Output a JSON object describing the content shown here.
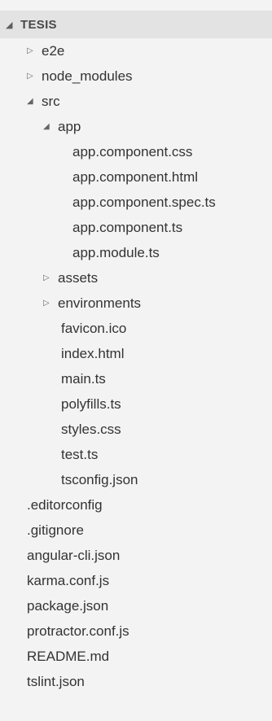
{
  "explorer": {
    "section_title": "TESIS",
    "twisty_expanded": "◢",
    "twisty_collapsed": "▷",
    "items": [
      {
        "label": "e2e"
      },
      {
        "label": "node_modules"
      },
      {
        "label": "src"
      },
      {
        "label": "app"
      },
      {
        "label": "app.component.css"
      },
      {
        "label": "app.component.html"
      },
      {
        "label": "app.component.spec.ts"
      },
      {
        "label": "app.component.ts"
      },
      {
        "label": "app.module.ts"
      },
      {
        "label": "assets"
      },
      {
        "label": "environments"
      },
      {
        "label": "favicon.ico"
      },
      {
        "label": "index.html"
      },
      {
        "label": "main.ts"
      },
      {
        "label": "polyfills.ts"
      },
      {
        "label": "styles.css"
      },
      {
        "label": "test.ts"
      },
      {
        "label": "tsconfig.json"
      },
      {
        "label": ".editorconfig"
      },
      {
        "label": ".gitignore"
      },
      {
        "label": "angular-cli.json"
      },
      {
        "label": "karma.conf.js"
      },
      {
        "label": "package.json"
      },
      {
        "label": "protractor.conf.js"
      },
      {
        "label": "README.md"
      },
      {
        "label": "tslint.json"
      }
    ]
  }
}
